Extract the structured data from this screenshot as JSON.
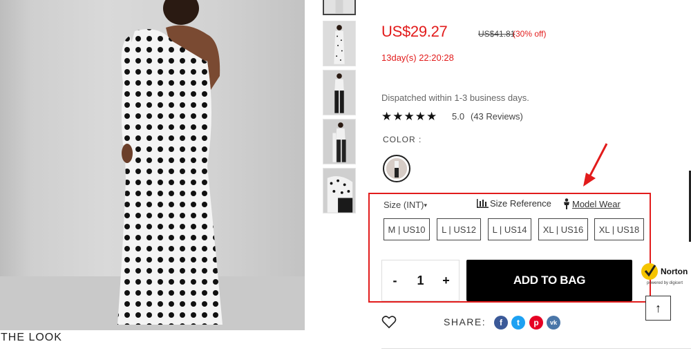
{
  "gallery": {
    "the_look_label": "THE LOOK"
  },
  "product": {
    "price": "US$29.27",
    "original_price": "US$41.81",
    "discount": "(30% off)",
    "countdown": "13day(s) 22:20:28",
    "dispatch": "Dispatched within 1-3 business days.",
    "stars": "★★★★★",
    "rating": "5.0",
    "reviews": "(43 Reviews)",
    "color_label": "COLOR :"
  },
  "size": {
    "label": "Size (INT)",
    "caret": "▾",
    "size_reference": "Size Reference",
    "model_wear": "Model Wear",
    "options": [
      "M | US10",
      "L | US12",
      "L | US14",
      "XL | US16",
      "XL | US18"
    ]
  },
  "purchase": {
    "minus": "-",
    "quantity": "1",
    "plus": "+",
    "add_to_bag": "ADD TO BAG",
    "scroll_top": "↑"
  },
  "badge": {
    "norton": "Norton",
    "powered_by": "powered by digicert"
  },
  "share": {
    "label": "SHARE:",
    "icons": [
      "facebook-icon",
      "twitter-icon",
      "pinterest-icon",
      "vk-icon"
    ],
    "facebook": "f",
    "twitter": "t",
    "pinterest": "p",
    "vk": "vk"
  },
  "colors": {
    "accent_red": "#e21b1b",
    "button_black": "#000000",
    "facebook": "#3b5998",
    "twitter": "#1da1f2",
    "pinterest": "#e60023",
    "vk": "#4a76a8"
  }
}
